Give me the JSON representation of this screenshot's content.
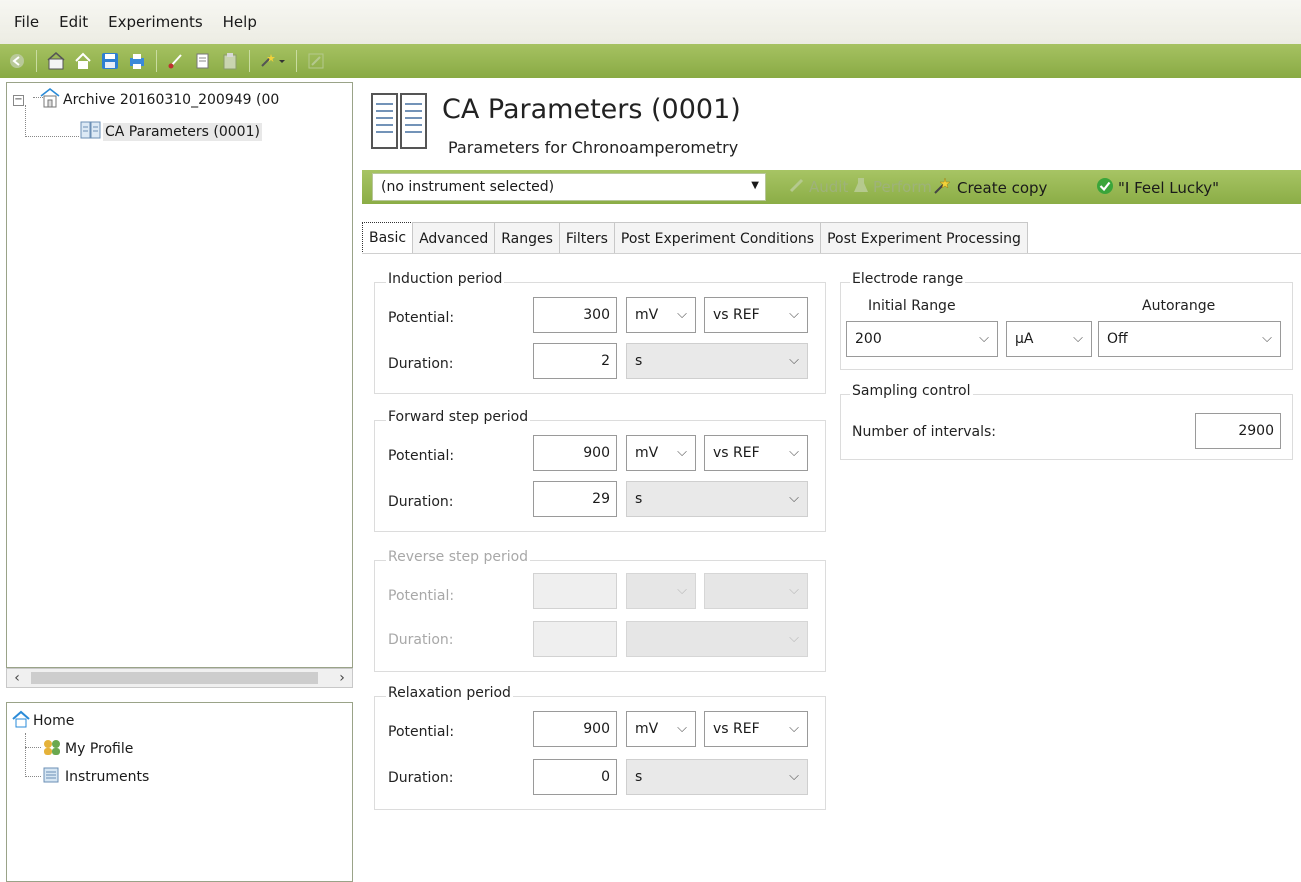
{
  "menu": [
    "File",
    "Edit",
    "Experiments",
    "Help"
  ],
  "tree": {
    "archive_label": "Archive 20160310_200949 (00",
    "params_label": "CA Parameters (0001)"
  },
  "home_tree": {
    "home": "Home",
    "profile": "My Profile",
    "instruments": "Instruments"
  },
  "header": {
    "title": "CA Parameters (0001)",
    "subtitle": "Parameters for Chronoamperometry"
  },
  "actions": {
    "instrument": "(no instrument selected)",
    "audit": "Audit",
    "perform": "Perform",
    "create_copy": "Create copy",
    "lucky": "\"I Feel Lucky\""
  },
  "tabs": [
    "Basic",
    "Advanced",
    "Ranges",
    "Filters",
    "Post Experiment Conditions",
    "Post Experiment Processing"
  ],
  "labels": {
    "potential": "Potential:",
    "duration": "Duration:"
  },
  "induction": {
    "title": "Induction period",
    "potential": "300",
    "pot_unit": "mV",
    "ref": "vs REF",
    "duration": "2",
    "dur_unit": "s"
  },
  "forward": {
    "title": "Forward step period",
    "potential": "900",
    "pot_unit": "mV",
    "ref": "vs REF",
    "duration": "29",
    "dur_unit": "s"
  },
  "reverse": {
    "title": "Reverse step period",
    "potential": "",
    "duration": ""
  },
  "relaxation": {
    "title": "Relaxation period",
    "potential": "900",
    "pot_unit": "mV",
    "ref": "vs REF",
    "duration": "0",
    "dur_unit": "s"
  },
  "electrode": {
    "title": "Electrode range",
    "initial_label": "Initial Range",
    "autorange_label": "Autorange",
    "initial_value": "200",
    "unit": "µA",
    "autorange_value": "Off"
  },
  "sampling": {
    "title": "Sampling control",
    "intervals_label": "Number of intervals:",
    "intervals_value": "2900"
  }
}
